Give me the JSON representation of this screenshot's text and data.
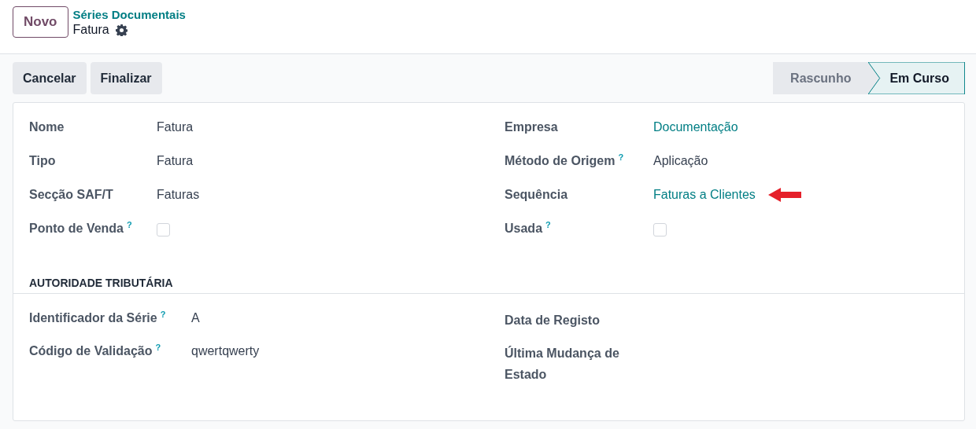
{
  "header": {
    "new_button": "Novo",
    "breadcrumb": "Séries Documentais",
    "record_title": "Fatura"
  },
  "actions": [
    "Cancelar",
    "Finalizar"
  ],
  "stages": [
    {
      "label": "Rascunho",
      "selected": false
    },
    {
      "label": "Em Curso",
      "selected": true
    }
  ],
  "main_fields": {
    "left": [
      {
        "label": "Nome",
        "kind": "text",
        "value": "Fatura"
      },
      {
        "label": "Tipo",
        "kind": "text",
        "value": "Fatura"
      },
      {
        "label": "Secção SAF/T",
        "kind": "text",
        "value": "Faturas"
      },
      {
        "label": "Ponto de Venda",
        "help": "?",
        "kind": "checkbox",
        "checked": false
      }
    ],
    "right": [
      {
        "label": "Empresa",
        "kind": "link",
        "value": "Documentação"
      },
      {
        "label": "Método de Origem",
        "help": "?",
        "kind": "text",
        "value": "Aplicação"
      },
      {
        "label": "Sequência",
        "kind": "link",
        "value": "Faturas a Clientes",
        "pointer_arrow": true
      },
      {
        "label": "Usada",
        "help": "?",
        "kind": "checkbox",
        "checked": false
      }
    ]
  },
  "section": {
    "title": "AUTORIDADE TRIBUTÁRIA",
    "left": [
      {
        "label": "Identificador da Série",
        "help": "?",
        "kind": "text",
        "value": "A"
      },
      {
        "label": "Código de Validação",
        "help": "?",
        "kind": "text",
        "value": "qwertqwerty"
      }
    ],
    "right": [
      {
        "label": "Data de Registo"
      },
      {
        "label": "Última Mudança de Estado"
      }
    ]
  }
}
